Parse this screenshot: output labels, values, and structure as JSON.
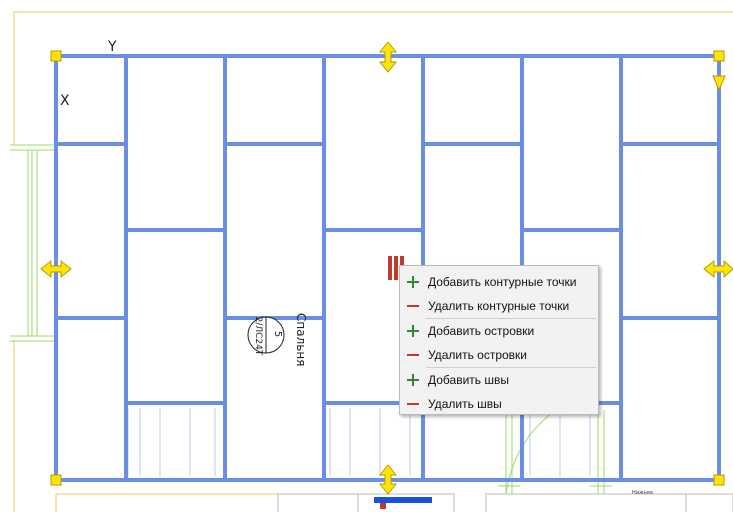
{
  "canvas": {
    "axis_label_y": "Y",
    "axis_label_x": "X",
    "room_name": "Спальня",
    "room_number": "5",
    "room_code": "2/ЛС24Т",
    "bottom_room_label": "Нижняя",
    "colors": {
      "grid_line": "#6a8ee6",
      "grip": "#ffe600",
      "wall": "#99dd66",
      "border": "#f2c464",
      "accent_red": "#c0392b",
      "accent_blue": "#1a52e0"
    }
  },
  "context_menu": {
    "items": [
      {
        "label": "Добавить контурные точки",
        "icon": "plus-icon"
      },
      {
        "label": "Удалить контурные точки",
        "icon": "minus-icon"
      },
      {
        "label": "Добавить островки",
        "icon": "plus-icon"
      },
      {
        "label": "Удалить островки",
        "icon": "minus-icon"
      },
      {
        "label": "Добавить швы",
        "icon": "plus-icon"
      },
      {
        "label": "Удалить швы",
        "icon": "minus-icon"
      }
    ]
  }
}
